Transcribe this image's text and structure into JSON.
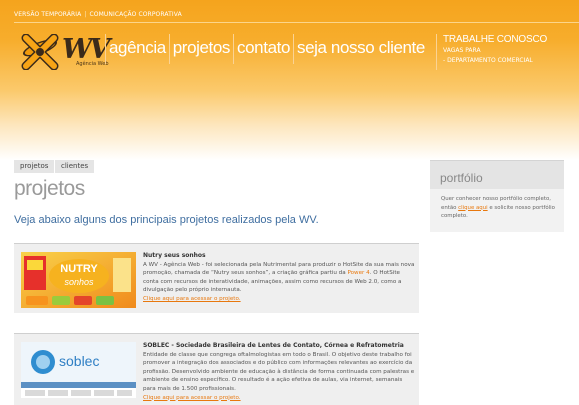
{
  "topbar": {
    "version": "VERSÃO TEMPORÁRIA",
    "separator": "|",
    "corp": "COMUNICAÇÃO CORPORATIVA"
  },
  "logo": {
    "brand": "WV",
    "subtitle": "Agência Web"
  },
  "nav": {
    "items": [
      "agência",
      "projetos",
      "contato",
      "seja nosso cliente"
    ]
  },
  "side_nav": {
    "title": "TRABALHE CONOSCO",
    "line1": "VAGAS PARA",
    "line2": "- DEPARTAMENTO COMERCIAL"
  },
  "tabs": [
    "projetos",
    "clientes"
  ],
  "page": {
    "title": "projetos",
    "intro": "Veja abaixo alguns dos principais projetos realizados pela WV."
  },
  "projects": [
    {
      "title": "Nutry seus sonhos",
      "desc_a": "A WV - Agência Web - foi selecionada pela Nutrimental para produzir o HotSite da sua mais nova promoção, chamada de “Nutry seus sonhos”, a criação gráfica partiu da ",
      "highlight": "Power 4",
      "desc_b": ". O HotSite conta com recursos de interatividade, animações, assim como recursos de Web 2.0, como a divulgação pelo próprio internauta.",
      "link": "Clique aqui para acessar o projeto.",
      "thumb_text": "NUTRY seus sonhos"
    },
    {
      "title": "SOBLEC - Sociedade Brasileira de Lentes de Contato, Córnea e Refratometria",
      "desc_a": "Entidade de classe que congrega oftalmologistas em todo o Brasil. O objetivo deste trabalho foi promover a integração dos associados e do público com informações relevantes ao exercício da profissão. Desenvolvido ambiente de educação à distância de forma continuada com palestras e ambiente de ensino específico. O resultado é a ação efetiva de aulas, via internet, semanais para mais de 1.500 profissionais.",
      "highlight": "",
      "desc_b": "",
      "link": "Clique aqui para acessar o projeto.",
      "thumb_text": "soblec"
    }
  ],
  "portfolio": {
    "title": "portfólio",
    "text_a": "Quer conhecer nosso portfólio completo, então ",
    "link": "clique aqui",
    "text_b": " e solicite nosso portfólio completo."
  },
  "colors": {
    "orange": "#f5a41d",
    "link": "#e8780e",
    "intro_blue": "#3f6ea0"
  }
}
